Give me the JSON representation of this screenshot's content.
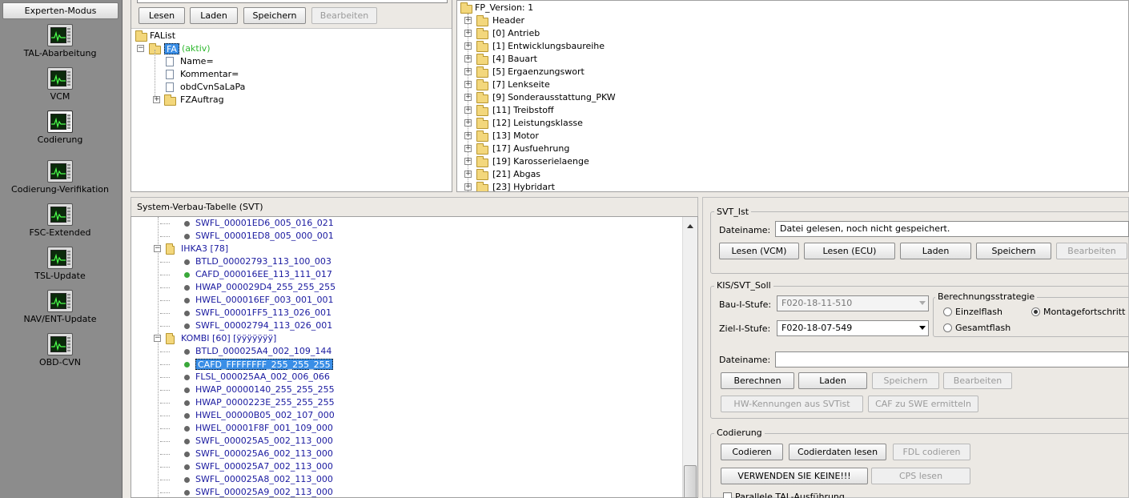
{
  "sidebar": {
    "expert_button": "Experten-Modus",
    "items": [
      {
        "label": "TAL-Abarbeitung",
        "icon": "monitor-icon"
      },
      {
        "label": "VCM",
        "icon": "monitor-icon"
      },
      {
        "label": "Codierung",
        "icon": "monitor-icon"
      },
      {
        "label": "Codierung-Verifikation",
        "icon": "monitor-icon"
      },
      {
        "label": "FSC-Extended",
        "icon": "monitor-icon"
      },
      {
        "label": "TSL-Update",
        "icon": "monitor-icon"
      },
      {
        "label": "NAV/ENT-Update",
        "icon": "monitor-icon"
      },
      {
        "label": "OBD-CVN",
        "icon": "monitor-icon"
      }
    ]
  },
  "fa_panel": {
    "buttons": {
      "lesen": "Lesen",
      "laden": "Laden",
      "speichern": "Speichern",
      "bearbeiten": "Bearbeiten"
    },
    "tree": {
      "root": "FAList",
      "fa": "FA",
      "fa_state": "(aktiv)",
      "children": [
        "Name=",
        "Kommentar=",
        "obdCvnSaLaPa",
        "FZAuftrag"
      ]
    }
  },
  "fp_panel": {
    "root": "FP_Version: 1",
    "items": [
      "Header",
      "[0] Antrieb",
      "[1] Entwicklungsbaureihe",
      "[4] Bauart",
      "[5] Ergaenzungswort",
      "[7] Lenkseite",
      "[9] Sonderausstattung_PKW",
      "[11] Treibstoff",
      "[12] Leistungsklasse",
      "[13] Motor",
      "[17] Ausfuehrung",
      "[19] Karosserielaenge",
      "[21] Abgas",
      "[23] Hybridart"
    ]
  },
  "svt_panel": {
    "title": "System-Verbau-Tabelle (SVT)",
    "rows": [
      {
        "type": "item",
        "text": "SWFL_00001ED6_005_016_021",
        "dot": "gray"
      },
      {
        "type": "item",
        "text": "SWFL_00001ED8_005_000_001",
        "dot": "gray"
      },
      {
        "type": "group",
        "text": "IHKA3 [78]"
      },
      {
        "type": "item",
        "text": "BTLD_00002793_113_100_003",
        "dot": "gray"
      },
      {
        "type": "item",
        "text": "CAFD_000016EE_113_111_017",
        "dot": "green"
      },
      {
        "type": "item",
        "text": "HWAP_000029D4_255_255_255",
        "dot": "gray"
      },
      {
        "type": "item",
        "text": "HWEL_000016EF_003_001_001",
        "dot": "gray"
      },
      {
        "type": "item",
        "text": "SWFL_00001FF5_113_026_001",
        "dot": "gray"
      },
      {
        "type": "item",
        "text": "SWFL_00002794_113_026_001",
        "dot": "gray"
      },
      {
        "type": "group",
        "text": "KOMBI [60] [ÿÿÿÿÿÿÿ]"
      },
      {
        "type": "item",
        "text": "BTLD_000025A4_002_109_144",
        "dot": "gray"
      },
      {
        "type": "item",
        "text": "CAFD_FFFFFFFF_255_255_255",
        "dot": "green",
        "selected": true
      },
      {
        "type": "item",
        "text": "FLSL_000025AA_002_006_066",
        "dot": "gray"
      },
      {
        "type": "item",
        "text": "HWAP_00000140_255_255_255",
        "dot": "gray"
      },
      {
        "type": "item",
        "text": "HWAP_0000223E_255_255_255",
        "dot": "gray"
      },
      {
        "type": "item",
        "text": "HWEL_00000B05_002_107_000",
        "dot": "gray"
      },
      {
        "type": "item",
        "text": "HWEL_00001F8F_001_109_000",
        "dot": "gray"
      },
      {
        "type": "item",
        "text": "SWFL_000025A5_002_113_000",
        "dot": "gray"
      },
      {
        "type": "item",
        "text": "SWFL_000025A6_002_113_000",
        "dot": "gray"
      },
      {
        "type": "item",
        "text": "SWFL_000025A7_002_113_000",
        "dot": "gray"
      },
      {
        "type": "item",
        "text": "SWFL_000025A8_002_113_000",
        "dot": "gray"
      },
      {
        "type": "item",
        "text": "SWFL_000025A9_002_113_000",
        "dot": "gray"
      }
    ]
  },
  "svt_ist": {
    "legend": "SVT_Ist",
    "dateiname_label": "Dateiname:",
    "dateiname_value": "Datei gelesen, noch nicht gespeichert.",
    "buttons": {
      "lesen_vcm": "Lesen (VCM)",
      "lesen_ecu": "Lesen (ECU)",
      "laden": "Laden",
      "speichern": "Speichern",
      "bearbeiten": "Bearbeiten"
    }
  },
  "kis_svt_soll": {
    "legend": "KIS/SVT_Soll",
    "bau_label": "Bau-I-Stufe:",
    "bau_value": "F020-18-11-510",
    "ziel_label": "Ziel-I-Stufe:",
    "ziel_value": "F020-18-07-549",
    "strategie_legend": "Berechnungsstrategie",
    "radio_einzelflash": "Einzelflash",
    "radio_montage": "Montagefortschritt",
    "radio_gesamtflash": "Gesamtflash",
    "dateiname_label": "Dateiname:",
    "dateiname_value": "",
    "buttons": {
      "berechnen": "Berechnen",
      "laden": "Laden",
      "speichern": "Speichern",
      "bearbeiten": "Bearbeiten",
      "hw_kennungen": "HW-Kennungen aus SVTist",
      "caf_swe": "CAF zu SWE ermitteln"
    }
  },
  "codierung": {
    "legend": "Codierung",
    "buttons": {
      "codieren": "Codieren",
      "codierdaten": "Codierdaten lesen",
      "fdl": "FDL codieren",
      "verwenden": "VERWENDEN SIE KEINE!!!",
      "cps": "CPS lesen"
    },
    "checkbox_label": "Parallele TAL-Ausführung"
  }
}
